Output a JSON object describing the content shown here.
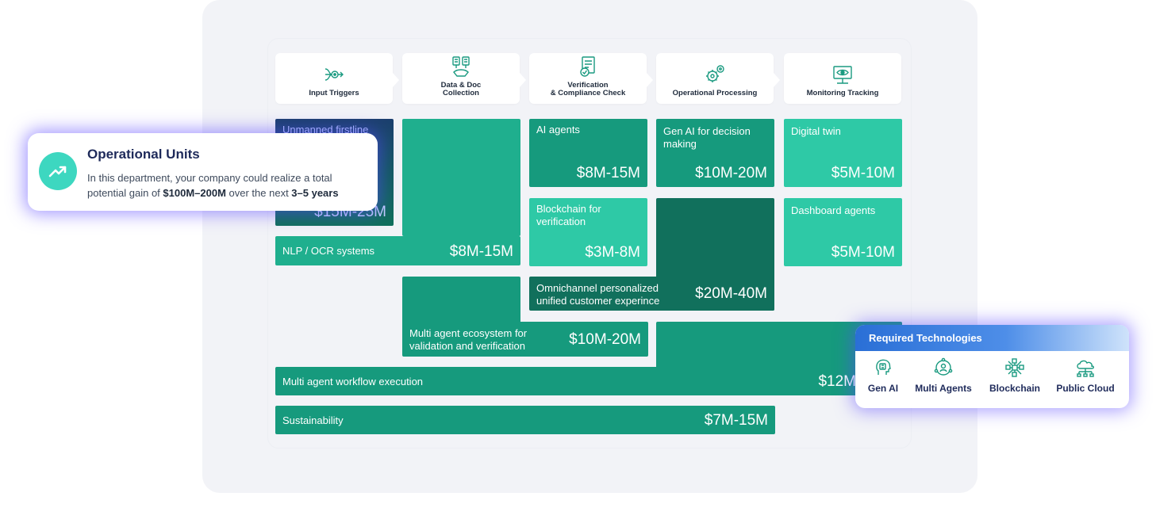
{
  "stages": [
    {
      "label": "Input Triggers",
      "icon": "input-triggers-icon"
    },
    {
      "label": "Data & Doc\nCollection",
      "icon": "data-doc-icon"
    },
    {
      "label": "Verification\n& Compliance Check",
      "icon": "verification-icon"
    },
    {
      "label": "Operational Processing",
      "icon": "gears-icon"
    },
    {
      "label": "Monitoring Tracking",
      "icon": "monitoring-icon"
    }
  ],
  "tiles": {
    "unmanned": {
      "title": "Unmanned firstline",
      "value": "$15M-25M"
    },
    "nlp": {
      "title": "NLP / OCR systems",
      "value": "$8M-15M"
    },
    "ai_agents": {
      "title": "AI agents",
      "value": "$8M-15M"
    },
    "blockchain": {
      "title": "Blockchain for verification",
      "value": "$3M-8M"
    },
    "genai": {
      "title": "Gen AI for decision making",
      "value": "$10M-20M"
    },
    "omni": {
      "title": "Omnichannel personalized unified customer experince",
      "value": "$20M-40M"
    },
    "twin": {
      "title": "Digital twin",
      "value": "$5M-10M"
    },
    "dashboard": {
      "title": "Dashboard agents",
      "value": "$5M-10M"
    },
    "multi_eco": {
      "title": "Multi agent ecosystem for validation and verification",
      "value": "$10M-20M"
    },
    "workflow": {
      "title": "Multi agent workflow execution",
      "value": "$12M"
    },
    "sustain": {
      "title": "Sustainability",
      "value": "$7M-15M"
    }
  },
  "ops_popup": {
    "title": "Operational Units",
    "text_1": "In this department, your company could realize a total potential gain of ",
    "gain": "$100M–200M",
    "text_2": " over the next ",
    "years": "3–5 years",
    "icon": "trend-up-icon"
  },
  "tech_popup": {
    "title": "Required Technologies",
    "items": [
      {
        "label": "Gen AI",
        "icon": "ai-head-icon"
      },
      {
        "label": "Multi Agents",
        "icon": "multi-agents-icon"
      },
      {
        "label": "Blockchain",
        "icon": "blockchain-icon"
      },
      {
        "label": "Public Cloud",
        "icon": "cloud-icon"
      }
    ]
  },
  "colors": {
    "accent": "#1faf8e",
    "dark": "#11705c",
    "light": "#2ec9a6",
    "glow": "#5a46ff",
    "heading": "#1e2a5a"
  }
}
